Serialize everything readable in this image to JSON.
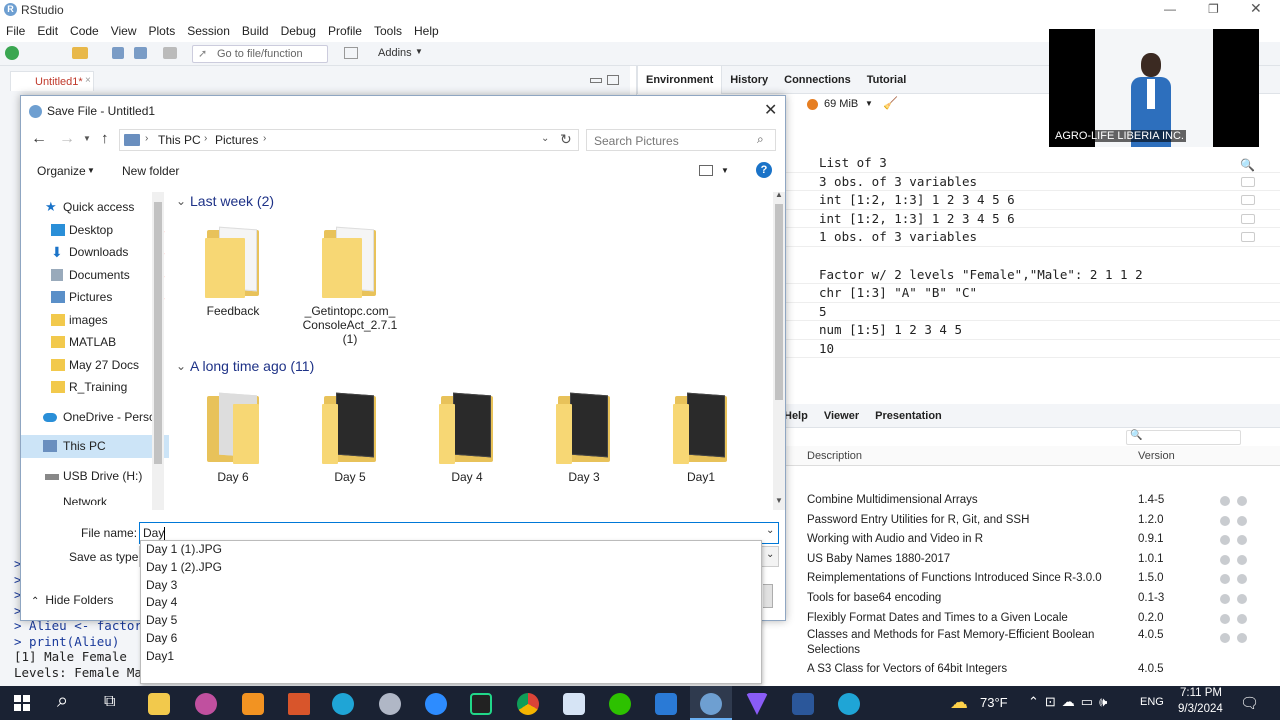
{
  "window": {
    "app_title": "RStudio"
  },
  "menu": [
    "File",
    "Edit",
    "Code",
    "View",
    "Plots",
    "Session",
    "Build",
    "Debug",
    "Profile",
    "Tools",
    "Help"
  ],
  "toolbar": {
    "goto_placeholder": "Go to file/function",
    "addins_label": "Addins"
  },
  "editor": {
    "tab_label": "Untitled1*"
  },
  "env_pane": {
    "tabs": [
      "Environment",
      "History",
      "Connections",
      "Tutorial"
    ],
    "memory": "69 MiB",
    "rows_group1": [
      "List of  3",
      "3 obs. of 3 variables",
      "int [1:2, 1:3] 1 2 3 4 5 6",
      "int [1:2, 1:3] 1 2 3 4 5 6",
      "1 obs. of 3 variables"
    ],
    "rows_group2": [
      "Factor w/ 2 levels \"Female\",\"Male\": 2 1 1 2",
      "chr [1:3] \"A\" \"B\" \"C\"",
      "5",
      "num [1:5] 1 2 3 4 5",
      "10"
    ]
  },
  "files_pane": {
    "tabs": [
      "Help",
      "Viewer",
      "Presentation"
    ],
    "col_description": "Description",
    "col_version": "Version",
    "packages": [
      {
        "description": "Combine Multidimensional Arrays",
        "version": "1.4-5"
      },
      {
        "description": "Password Entry Utilities for R, Git, and SSH",
        "version": "1.2.0"
      },
      {
        "description": "Working with Audio and Video in R",
        "version": "0.9.1"
      },
      {
        "description": "US Baby Names 1880-2017",
        "version": "1.0.1"
      },
      {
        "description": "Reimplementations of Functions Introduced Since R-3.0.0",
        "version": "1.5.0"
      },
      {
        "description": "Tools for base64 encoding",
        "version": "0.1-3"
      },
      {
        "description": "Flexibly Format Dates and Times to a Given Locale",
        "version": "0.2.0"
      },
      {
        "description": "Classes and Methods for Fast Memory-Efficient Boolean",
        "version": "4.0.5"
      },
      {
        "description": "Selections",
        "version": ""
      },
      {
        "description": "A S3 Class for Vectors of 64bit Integers",
        "version": "4.0.5"
      }
    ]
  },
  "console": {
    "lines": [
      ">",
      ">",
      ">",
      ">",
      "> Alieu <- factor",
      "> print(Alieu)",
      "[1] Male   Female",
      "Levels: Female Ma"
    ]
  },
  "dialog": {
    "title": "Save File - Untitled1",
    "breadcrumb": [
      "This PC",
      "Pictures"
    ],
    "search_placeholder": "Search Pictures",
    "organize_label": "Organize",
    "new_folder_label": "New folder",
    "nav_items": [
      "Quick access",
      "Desktop",
      "Downloads",
      "Documents",
      "Pictures",
      "images",
      "MATLAB",
      "May 27 Docs",
      "R_Training",
      "OneDrive - Persor",
      "This PC",
      "USB Drive (H:)",
      "Network"
    ],
    "group_last_week": "Last week (2)",
    "group_long_ago": "A long time ago (11)",
    "last_week_items": [
      "Feedback",
      "_Getintopc.com_ConsoleAct_2.7.1 (1)"
    ],
    "long_ago_items": [
      "Day 6",
      "Day 5",
      "Day 4",
      "Day 3",
      "Day1"
    ],
    "file_name_label": "File name:",
    "file_name_value": "Day",
    "save_as_type_label": "Save as type:",
    "hide_folders_label": "Hide Folders",
    "autocomplete": [
      "Day 1 (1).JPG",
      "Day 1 (2).JPG",
      "Day 3",
      "Day 4",
      "Day 5",
      "Day 6",
      "Day1"
    ]
  },
  "webcam": {
    "caption": "AGRO-LIFE LIBERIA INC."
  },
  "taskbar": {
    "temperature": "73°F",
    "lang": "ENG",
    "time": "7:11 PM",
    "date": "9/3/2024"
  }
}
